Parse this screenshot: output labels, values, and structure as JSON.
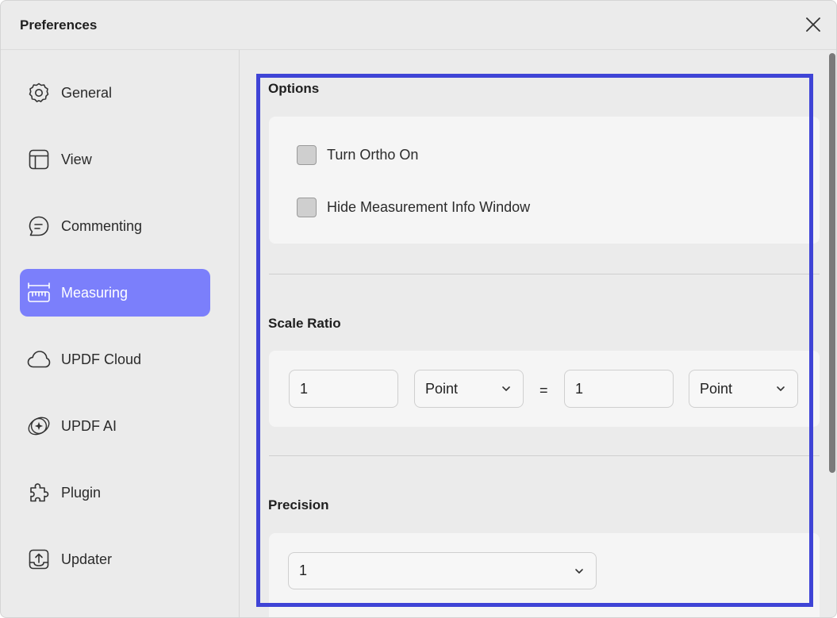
{
  "window": {
    "title": "Preferences",
    "close_label": "close"
  },
  "sidebar": {
    "items": [
      {
        "label": "General",
        "icon": "gear-icon",
        "active": false
      },
      {
        "label": "View",
        "icon": "layout-icon",
        "active": false
      },
      {
        "label": "Commenting",
        "icon": "comment-icon",
        "active": false
      },
      {
        "label": "Measuring",
        "icon": "ruler-icon",
        "active": true
      },
      {
        "label": "UPDF Cloud",
        "icon": "cloud-icon",
        "active": false
      },
      {
        "label": "UPDF AI",
        "icon": "ai-sparkle-icon",
        "active": false
      },
      {
        "label": "Plugin",
        "icon": "puzzle-icon",
        "active": false
      },
      {
        "label": "Updater",
        "icon": "upload-icon",
        "active": false
      }
    ]
  },
  "main": {
    "options": {
      "title": "Options",
      "checkboxes": [
        {
          "label": "Turn Ortho On",
          "checked": false
        },
        {
          "label": "Hide Measurement Info Window",
          "checked": false
        }
      ]
    },
    "scale_ratio": {
      "title": "Scale Ratio",
      "left_value": "1",
      "left_unit": "Point",
      "equals": "=",
      "right_value": "1",
      "right_unit": "Point"
    },
    "precision": {
      "title": "Precision",
      "value": "1"
    }
  },
  "colors": {
    "accent": "#7b7ffb",
    "focus_frame": "#3f44d6",
    "window_bg": "#ebebeb",
    "card_bg": "#f5f5f5"
  }
}
